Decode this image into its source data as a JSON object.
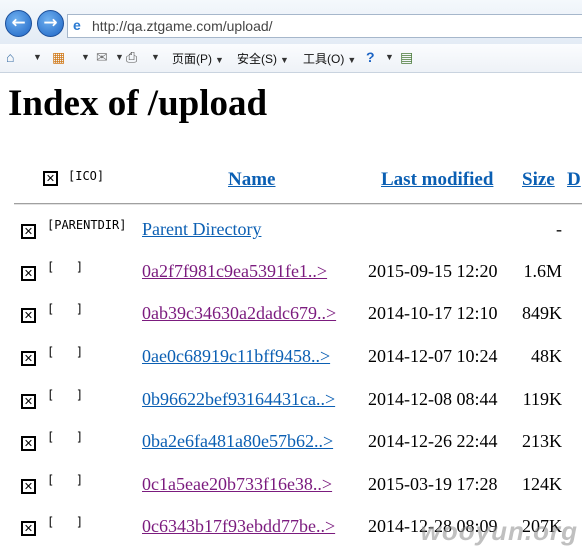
{
  "browser": {
    "url": "http://qa.ztgame.com/upload/",
    "back_glyph": "←",
    "forward_glyph": "→"
  },
  "command_bar": {
    "page_menu": "页面(P)",
    "safety_menu": "安全(S)",
    "tools_menu": "工具(O)"
  },
  "page": {
    "title": "Index of /upload"
  },
  "table": {
    "header_icon_alt": "[ICO]",
    "columns": {
      "name": "Name",
      "last_modified": "Last modified",
      "size": "Size",
      "description": "D"
    },
    "parent": {
      "alt": "[PARENTDIR]",
      "name": "Parent Directory",
      "size": "-"
    },
    "rows": [
      {
        "alt": "[   ]",
        "name": "0a2f7f981c9ea5391fe1..>",
        "modified": "2015-09-15 12:20",
        "size": "1.6M",
        "visited": true
      },
      {
        "alt": "[   ]",
        "name": "0ab39c34630a2dadc679..>",
        "modified": "2014-10-17 12:10",
        "size": "849K",
        "visited": true
      },
      {
        "alt": "[   ]",
        "name": "0ae0c68919c11bff9458..>",
        "modified": "2014-12-07 10:24",
        "size": "48K",
        "visited": false
      },
      {
        "alt": "[   ]",
        "name": "0b96622bef93164431ca..>",
        "modified": "2014-12-08 08:44",
        "size": "119K",
        "visited": false
      },
      {
        "alt": "[   ]",
        "name": "0ba2e6fa481a80e57b62..>",
        "modified": "2014-12-26 22:44",
        "size": "213K",
        "visited": false
      },
      {
        "alt": "[   ]",
        "name": "0c1a5eae20b733f16e38..>",
        "modified": "2015-03-19 17:28",
        "size": "124K",
        "visited": true
      },
      {
        "alt": "[   ]",
        "name": "0c6343b17f93ebdd77be..>",
        "modified": "2014-12-28 08:09",
        "size": "207K",
        "visited": true
      }
    ]
  },
  "watermark": "wooyun.org",
  "colors": {
    "link": "#0b5fb3",
    "visited": "#7b1b7e"
  }
}
